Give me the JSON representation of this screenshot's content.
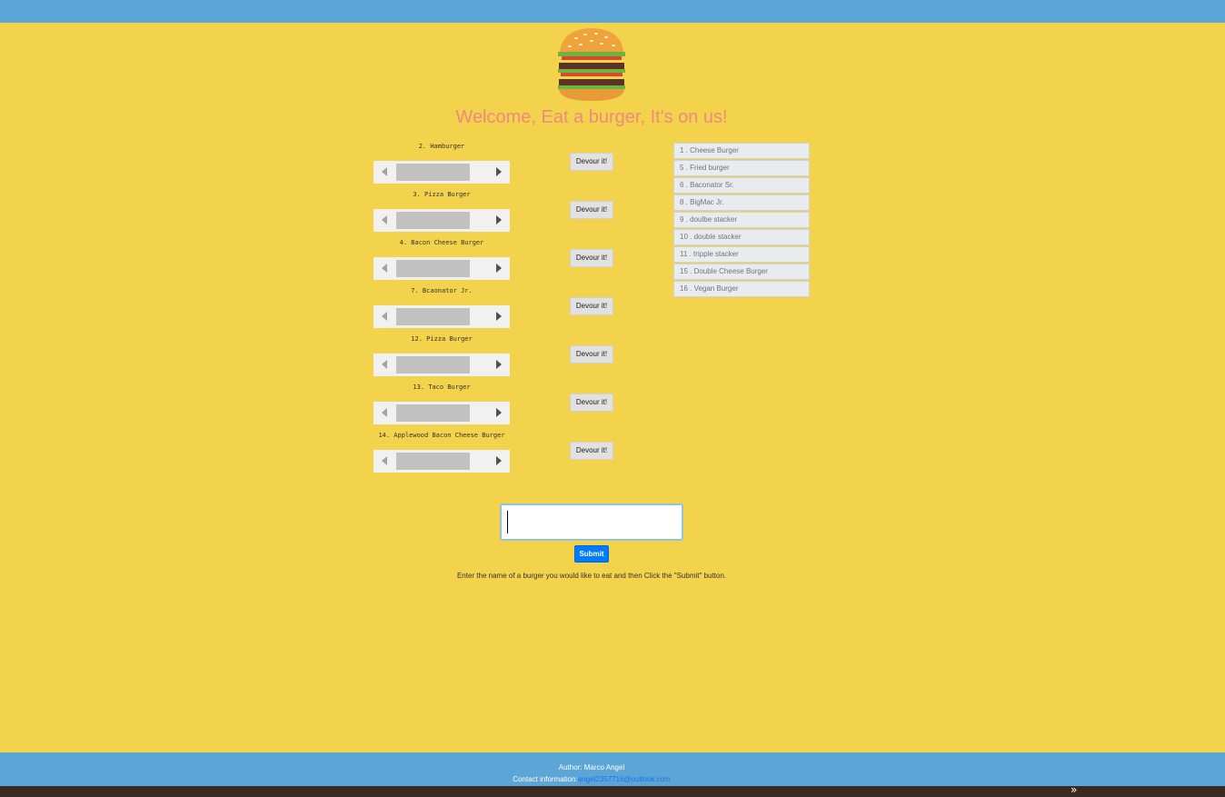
{
  "header": {
    "title": "Welcome, Eat a burger, It's on us!",
    "logo_icon": "burger-icon"
  },
  "uneaten_burgers": [
    {
      "label": "2. Hamburger",
      "button_label": "Devour it!"
    },
    {
      "label": "3. Pizza Burger",
      "button_label": "Devour it!"
    },
    {
      "label": "4. Bacon Cheese Burger",
      "button_label": "Devour it!"
    },
    {
      "label": "7. Bcaonator Jr.",
      "button_label": "Devour it!"
    },
    {
      "label": "12. Pizza Burger",
      "button_label": "Devour it!"
    },
    {
      "label": "13. Taco Burger",
      "button_label": "Devour it!"
    },
    {
      "label": "14. Applewood Bacon Cheese Burger",
      "button_label": "Devour it!"
    }
  ],
  "devoured_burgers": [
    "1 . Cheese Burger",
    "5 . Fried burger",
    "6 . Baconator Sr.",
    "8 . BigMac Jr.",
    "9 . doulbe stacker",
    "10 . double stacker",
    "11 . tripple stacker",
    "15 . Double Cheese Burger",
    "16 . Vegan Burger"
  ],
  "form": {
    "input_value": "",
    "submit_label": "Submit",
    "instructions": "Enter the name of a burger you would like to eat and then Click the \"Submit\" button."
  },
  "footer": {
    "author": "Author: Marco Angel",
    "contact_label": "Contact information:",
    "contact_email": "angel2357716@outlook.com"
  },
  "colors": {
    "background": "#f3d24c",
    "bars": "#5ca5d7",
    "title": "#ee8a80",
    "submit": "#007bff"
  }
}
